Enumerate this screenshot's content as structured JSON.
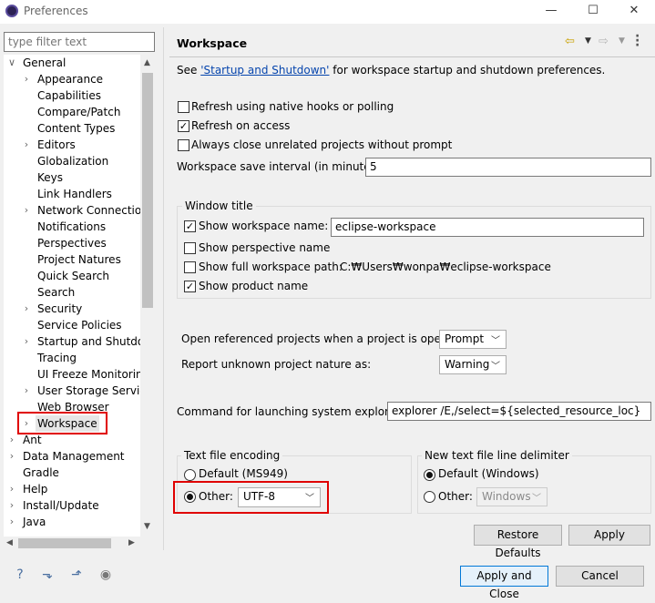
{
  "window": {
    "title": "Preferences",
    "controls": {
      "minimize": "—",
      "maximize": "☐",
      "close": "✕"
    }
  },
  "filter": {
    "placeholder": "type filter text"
  },
  "tree": {
    "items": [
      {
        "label": "General",
        "level": 0,
        "expanded": true
      },
      {
        "label": "Appearance",
        "level": 1,
        "collapsed": true
      },
      {
        "label": "Capabilities",
        "level": 1
      },
      {
        "label": "Compare/Patch",
        "level": 1
      },
      {
        "label": "Content Types",
        "level": 1
      },
      {
        "label": "Editors",
        "level": 1,
        "collapsed": true
      },
      {
        "label": "Globalization",
        "level": 1
      },
      {
        "label": "Keys",
        "level": 1
      },
      {
        "label": "Link Handlers",
        "level": 1
      },
      {
        "label": "Network Connection",
        "level": 1,
        "collapsed": true
      },
      {
        "label": "Notifications",
        "level": 1
      },
      {
        "label": "Perspectives",
        "level": 1
      },
      {
        "label": "Project Natures",
        "level": 1
      },
      {
        "label": "Quick Search",
        "level": 1
      },
      {
        "label": "Search",
        "level": 1
      },
      {
        "label": "Security",
        "level": 1,
        "collapsed": true
      },
      {
        "label": "Service Policies",
        "level": 1
      },
      {
        "label": "Startup and Shutdow",
        "level": 1,
        "collapsed": true
      },
      {
        "label": "Tracing",
        "level": 1
      },
      {
        "label": "UI Freeze Monitoring",
        "level": 1
      },
      {
        "label": "User Storage Service",
        "level": 1,
        "collapsed": true
      },
      {
        "label": "Web Browser",
        "level": 1
      },
      {
        "label": "Workspace",
        "level": 1,
        "collapsed": true,
        "selected": true
      },
      {
        "label": "Ant",
        "level": 0,
        "collapsed": true
      },
      {
        "label": "Data Management",
        "level": 0,
        "collapsed": true
      },
      {
        "label": "Gradle",
        "level": 0
      },
      {
        "label": "Help",
        "level": 0,
        "collapsed": true
      },
      {
        "label": "Install/Update",
        "level": 0,
        "collapsed": true
      },
      {
        "label": "Java",
        "level": 0,
        "collapsed": true
      }
    ]
  },
  "page": {
    "title": "Workspace",
    "intro_prefix": "See ",
    "intro_link": "'Startup and Shutdown'",
    "intro_suffix": " for workspace startup and shutdown preferences.",
    "refresh_native": {
      "label": "Refresh using native hooks or polling",
      "checked": false
    },
    "refresh_access": {
      "label": "Refresh on access",
      "checked": true
    },
    "always_close": {
      "label": "Always close unrelated projects without prompt",
      "checked": false
    },
    "save_interval": {
      "label": "Workspace save interval (in minutes):",
      "value": "5"
    },
    "window_title": {
      "group_label": "Window title",
      "show_name": {
        "label": "Show workspace name:",
        "checked": true,
        "value": "eclipse-workspace"
      },
      "show_perspective": {
        "label": "Show perspective name",
        "checked": false
      },
      "show_path": {
        "label": "Show full workspace path:",
        "checked": false,
        "value": "C:₩Users₩wonpa₩eclipse-workspace"
      },
      "show_product": {
        "label": "Show product name",
        "checked": true
      }
    },
    "open_referenced": {
      "label": "Open referenced projects when a project is opened:",
      "value": "Prompt"
    },
    "report_unknown": {
      "label": "Report unknown project nature as:",
      "value": "Warning"
    },
    "system_explorer": {
      "label": "Command for launching system explorer:",
      "value": "explorer /E,/select=${selected_resource_loc}"
    },
    "encoding": {
      "group_label": "Text file encoding",
      "default_label": "Default (MS949)",
      "other_label": "Other:",
      "other_value": "UTF-8",
      "selected": "other"
    },
    "line_delimiter": {
      "group_label": "New text file line delimiter",
      "default_label": "Default (Windows)",
      "other_label": "Other:",
      "other_value": "Windows",
      "selected": "default"
    },
    "restore_defaults": "Restore Defaults",
    "apply": "Apply"
  },
  "footer": {
    "apply_close": "Apply and Close",
    "cancel": "Cancel"
  },
  "colors": {
    "highlight_red": "#e00000",
    "link": "#0645ad",
    "selection": "#e6e6e6"
  }
}
